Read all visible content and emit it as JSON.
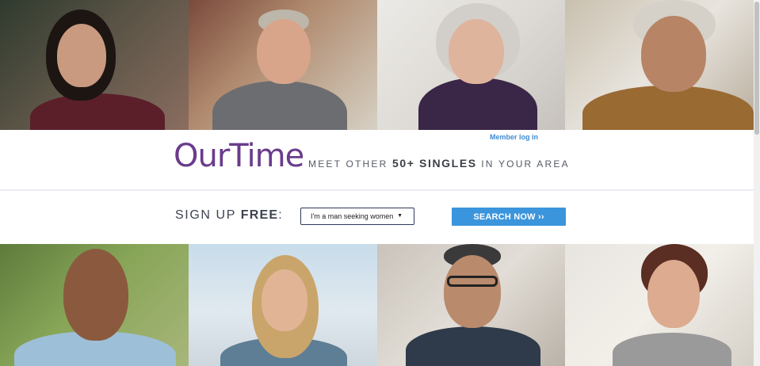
{
  "header": {
    "member_login": "Member log in",
    "logo_our": "Our",
    "logo_time": "Time",
    "tagline_pre": "MEET OTHER ",
    "tagline_bold": "50+ SINGLES",
    "tagline_post": " IN YOUR AREA"
  },
  "signup": {
    "label_pre": "SIGN UP ",
    "label_bold": "FREE",
    "label_post": ":",
    "select_value": "I'm a man seeking women",
    "search_button": "SEARCH NOW ››"
  },
  "colors": {
    "brand_purple": "#6a3c8c",
    "link_blue": "#3f8bd4",
    "button_blue": "#3b95dc"
  },
  "icons": {
    "select_arrow": "caret-down-icon"
  }
}
